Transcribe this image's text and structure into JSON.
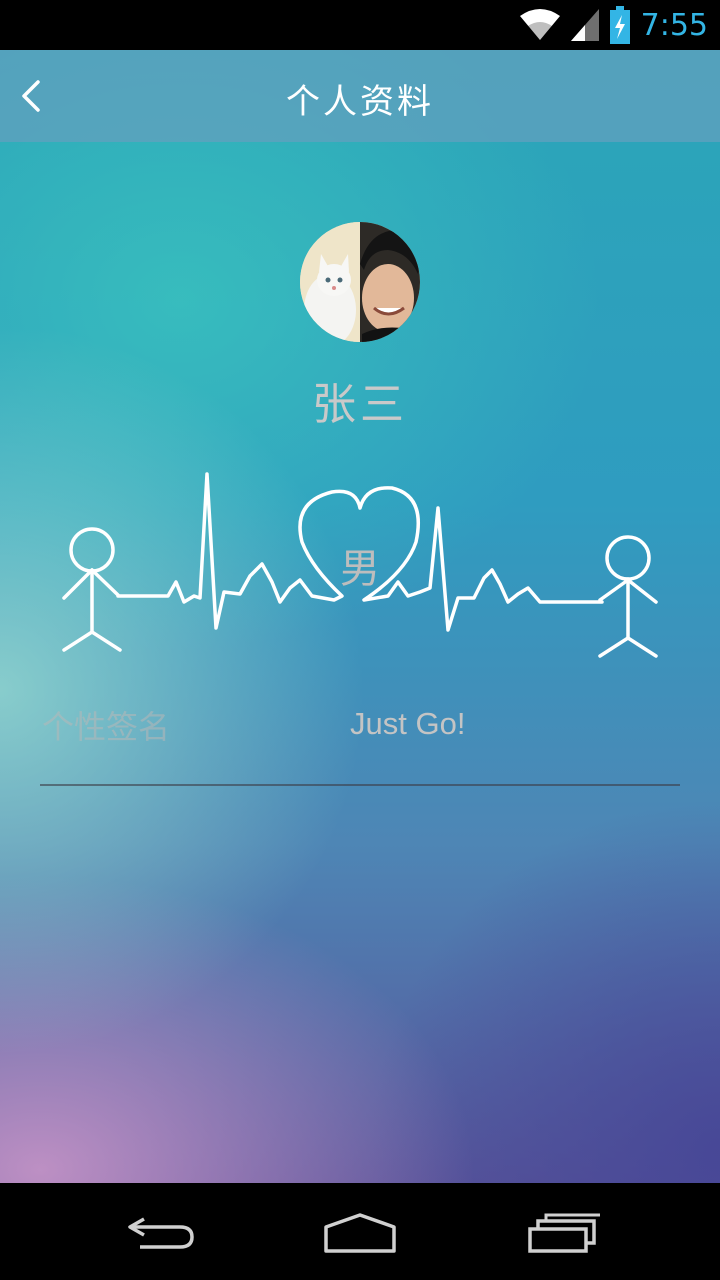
{
  "status_bar": {
    "time": "7:55",
    "accent_color": "#33b5e5",
    "icons": [
      "wifi-icon",
      "signal-icon",
      "battery-charging-icon"
    ]
  },
  "app_bar": {
    "title": "个人资料",
    "back_icon": "chevron-left-icon"
  },
  "profile": {
    "name": "张三",
    "gender": "男",
    "signature_label": "个性签名",
    "signature_value": "Just Go!"
  },
  "nav_bar": {
    "icons": [
      "back-nav-icon",
      "home-nav-icon",
      "recents-nav-icon"
    ]
  }
}
